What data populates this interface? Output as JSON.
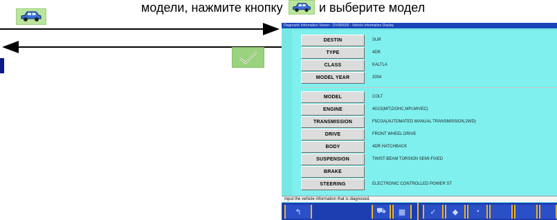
{
  "header": {
    "text_before_icon": "модели, нажмите кнопку",
    "text_after_icon": "и выберите модел"
  },
  "app": {
    "title": "Diagnostic Information Viewer - DV000000 - Vehicle Information Display",
    "rows_group1": [
      {
        "label": "DESTIN",
        "value": "SUR"
      },
      {
        "label": "TYPE",
        "value": "4DR"
      },
      {
        "label": "CLASS",
        "value": "KALTLA"
      },
      {
        "label": "MODEL YEAR",
        "value": "2004"
      }
    ],
    "rows_group2": [
      {
        "label": "MODEL",
        "value": "COLT"
      },
      {
        "label": "ENGINE",
        "value": "4G15(MIT,DOHC,MPI,MIVEC)"
      },
      {
        "label": "TRANSMISSION",
        "value": "F5CGA(AUTOMATED MANUAL TRANSMISSION,2WD)"
      },
      {
        "label": "DRIVE",
        "value": "FRONT WHEEL DRIVE"
      },
      {
        "label": "BODY",
        "value": "4DR HATCHBACK"
      },
      {
        "label": "SUSPENSION",
        "value": "TWIST-BEAM TORSION SEMI-FIXED"
      },
      {
        "label": "BRAKE",
        "value": ""
      },
      {
        "label": "STEERING",
        "value": "ELECTRONIC CONTROLLED POWER ST"
      }
    ],
    "status_text": "Input the vehicle information that is diagnosed.",
    "toolbar_icons": [
      "back-icon",
      "car-icon",
      "grid-icon",
      "check-icon",
      "diamond-icon",
      "gauge-icon"
    ],
    "toolbar_glyphs": {
      "back": "↰",
      "car": "⛟",
      "grid": "▦",
      "check": "✓",
      "diamond": "◆",
      "gauge": "◔"
    }
  },
  "colors": {
    "app_bg": "#75e8e6",
    "toolbar": "#1c3eb0",
    "button_green": "#b9e59d",
    "accent": "#f0b42a"
  }
}
